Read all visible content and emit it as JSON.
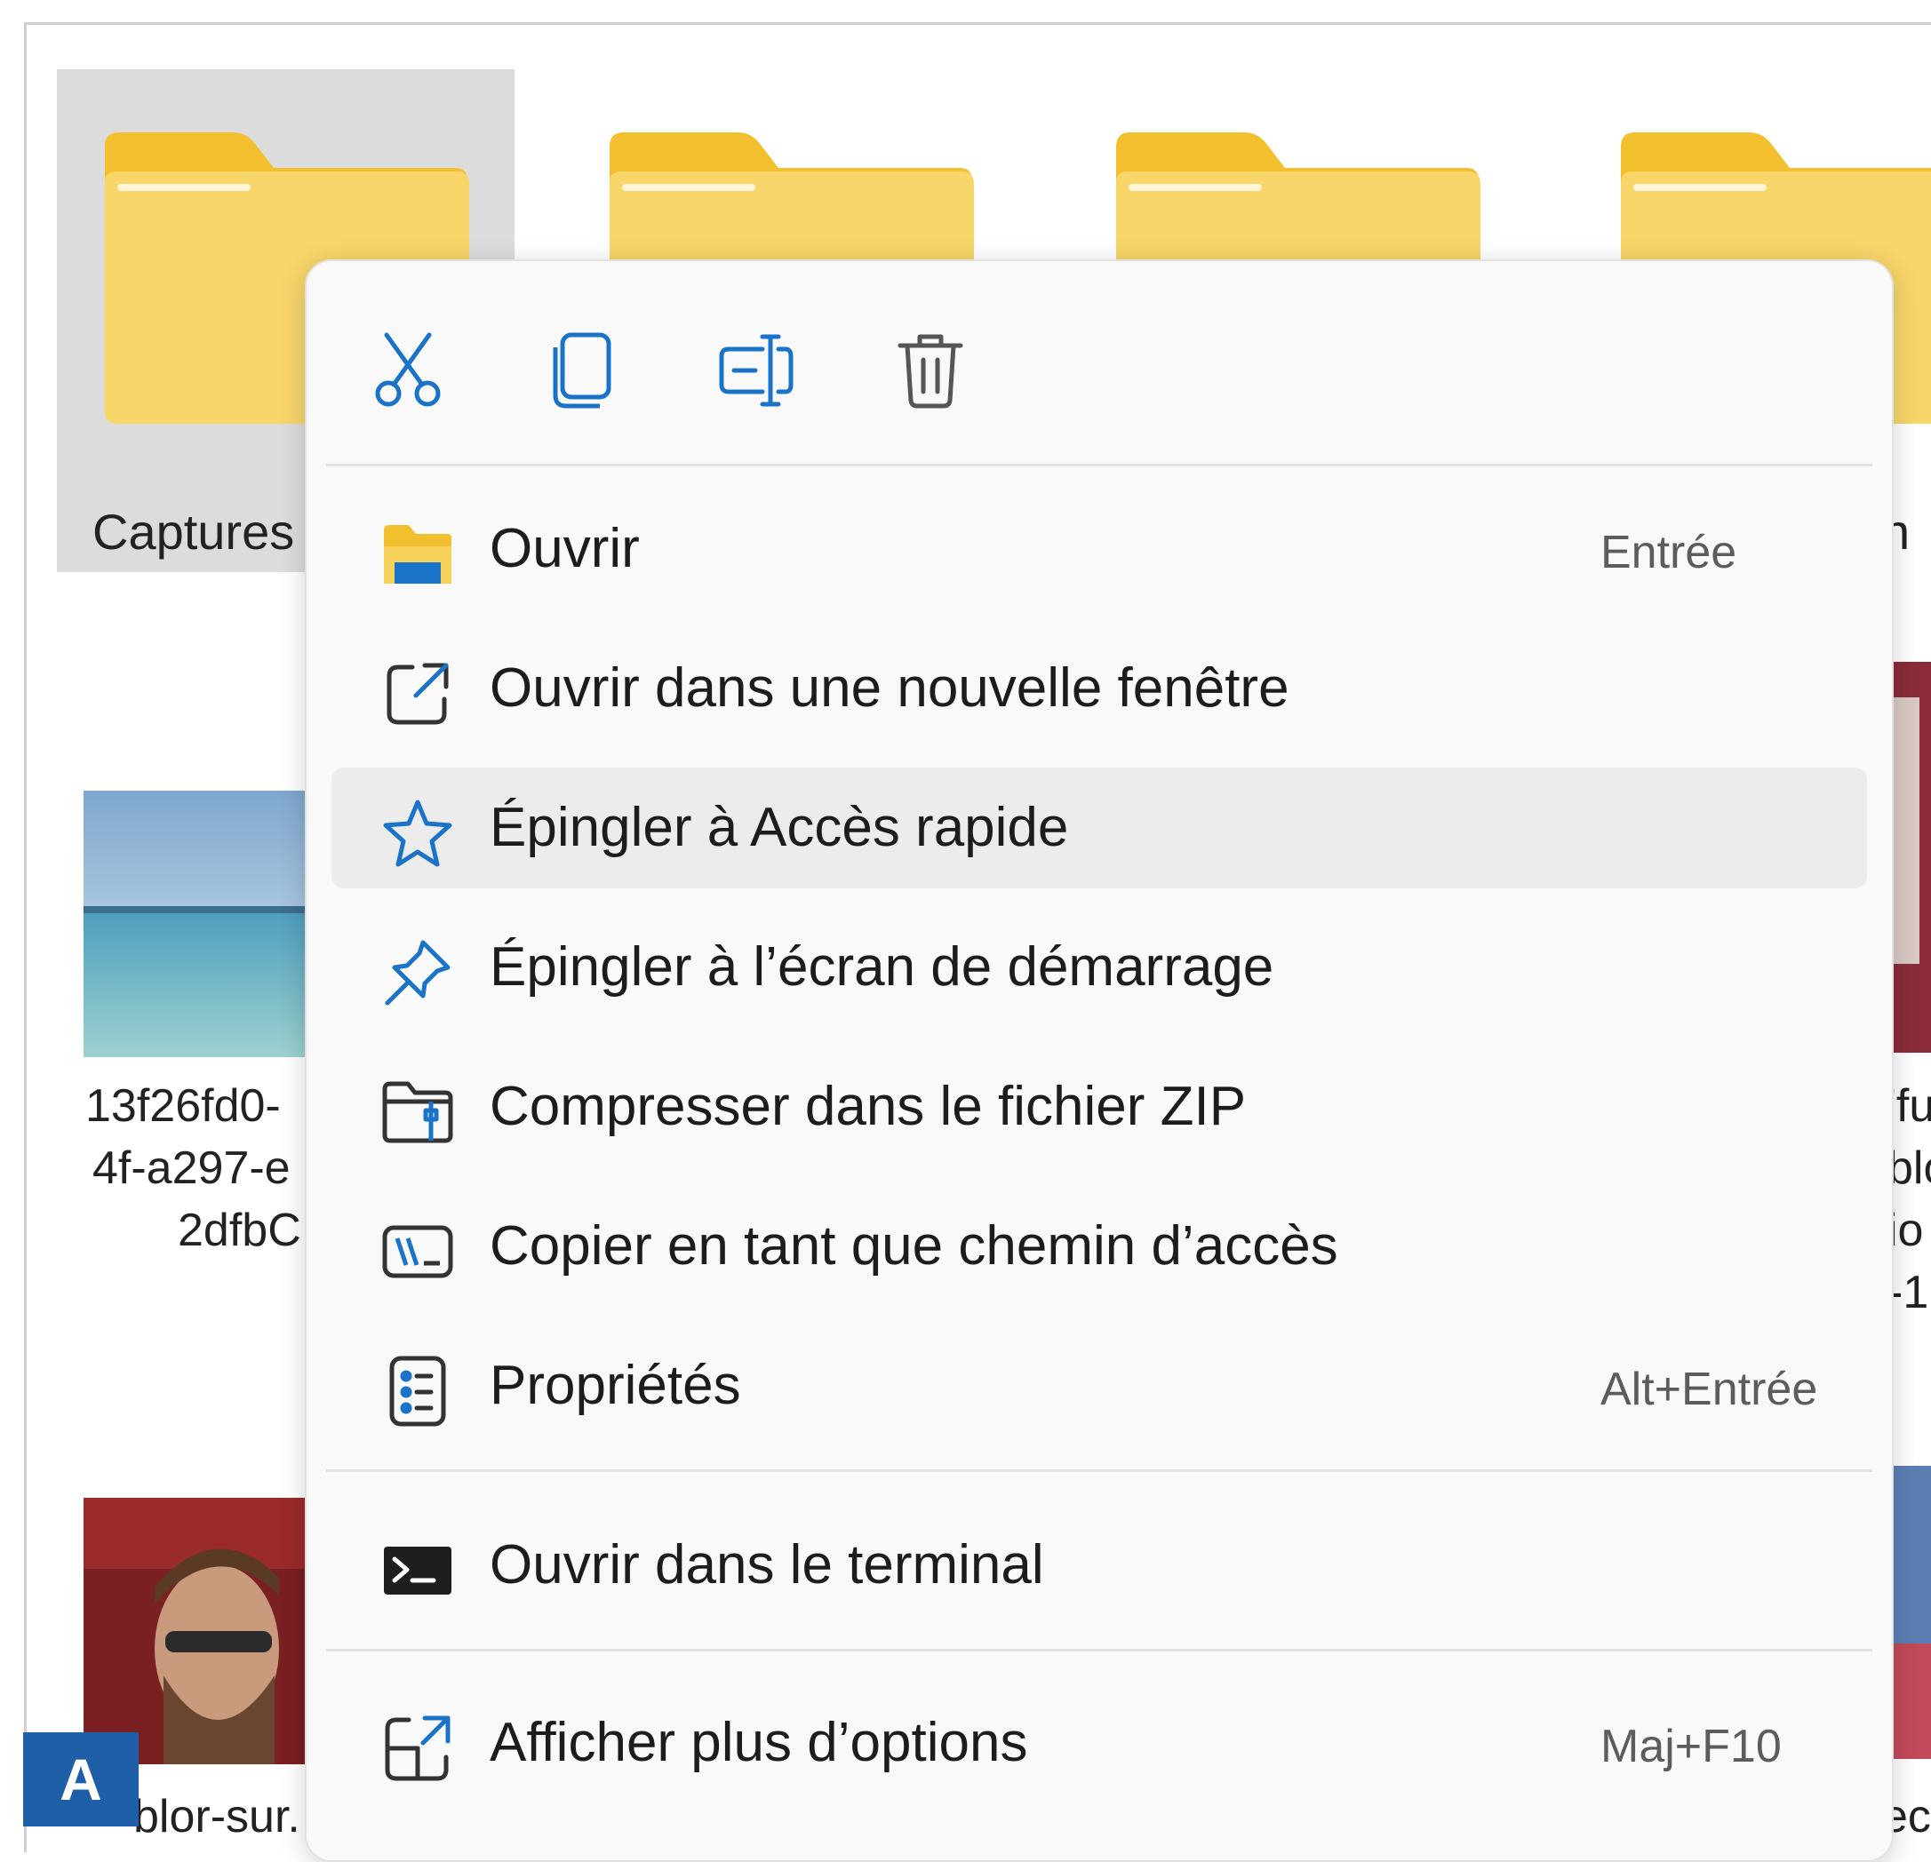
{
  "explorer": {
    "folders": [
      {
        "label": "Captures",
        "selected": true
      },
      {
        "label": "",
        "selected": false
      },
      {
        "label": "",
        "selected": false
      },
      {
        "label": "n",
        "selected": false
      }
    ],
    "files": [
      {
        "label_lines": [
          "13f26fd0-",
          "4f-a297-е",
          "2dfbC"
        ]
      },
      {
        "label_lines": [
          "blor-sur."
        ]
      }
    ],
    "right_edge_texts": [
      "'fu",
      "blo",
      "io",
      "-1",
      "ec"
    ],
    "badge": "A"
  },
  "colors": {
    "accent": "#1a73c8",
    "folder_yellow": "#f6d25a",
    "menu_bg": "#f9f9f9",
    "hover": "#ececec",
    "badge": "#1f5fa8"
  },
  "context_menu": {
    "toolbar": [
      {
        "name": "cut",
        "icon": "scissors-icon"
      },
      {
        "name": "copy",
        "icon": "copy-icon"
      },
      {
        "name": "rename",
        "icon": "rename-icon"
      },
      {
        "name": "delete",
        "icon": "trash-icon"
      }
    ],
    "items": [
      {
        "label": "Ouvrir",
        "shortcut": "Entrée",
        "icon": "folder-open-icon"
      },
      {
        "label": "Ouvrir dans une nouvelle fenêtre",
        "shortcut": "",
        "icon": "new-window-icon"
      },
      {
        "label": "Épingler à Accès rapide",
        "shortcut": "",
        "icon": "star-icon",
        "highlighted": true
      },
      {
        "label": "Épingler à l’écran de démarrage",
        "shortcut": "",
        "icon": "pin-icon"
      },
      {
        "label": "Compresser dans le fichier ZIP",
        "shortcut": "",
        "icon": "zip-folder-icon"
      },
      {
        "label": "Copier en tant que chemin d’accès",
        "shortcut": "",
        "icon": "copy-path-icon"
      },
      {
        "label": "Propriétés",
        "shortcut": "Alt+Entrée",
        "icon": "properties-icon"
      },
      {
        "label": "Ouvrir dans le terminal",
        "shortcut": "",
        "icon": "terminal-icon"
      },
      {
        "label": "Afficher plus d’options",
        "shortcut": "Maj+F10",
        "icon": "more-options-icon"
      }
    ]
  }
}
